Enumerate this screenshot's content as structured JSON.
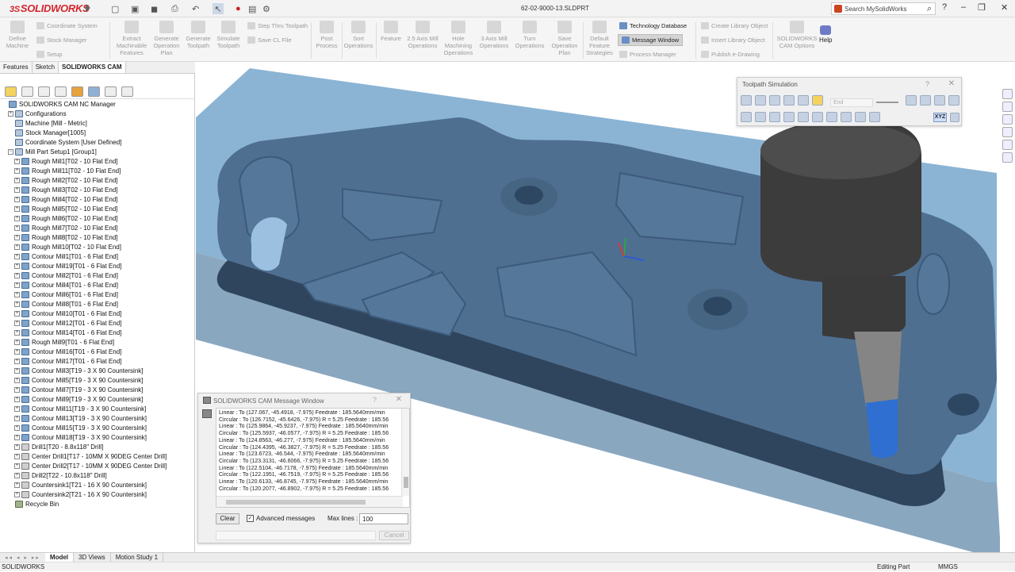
{
  "app": {
    "logo_prefix": "3S",
    "logo_text": "SOLIDWORKS",
    "document_title": "62-02-9000-13.SLDPRT"
  },
  "search": {
    "placeholder": "Search MySolidWorks",
    "icon": "search-icon"
  },
  "ribbon": {
    "define_machine": "Define Machine",
    "coordinate_system": "Coordinate System",
    "stock_manager": "Stock Manager",
    "setup": "Setup",
    "extract_features": "Extract Machinable Features",
    "generate_plan": "Generate Operation Plan",
    "generate_toolpath": "Generate Toolpath",
    "simulate_toolpath": "Simulate Toolpath",
    "step_thru": "Step Thru Toolpath",
    "save_cl": "Save CL File",
    "post_process": "Post Process",
    "sort_operations": "Sort Operations",
    "feature": "Feature",
    "axis25_mill": "2.5 Axis Mill Operations",
    "hole_machining": "Hole Machining Operations",
    "axis3_mill": "3 Axis Mill Operations",
    "turn_ops": "Turn Operations",
    "save_plan": "Save Operation Plan",
    "default_strategies": "Default Feature Strategies",
    "tech_db": "Technology Database",
    "message_window": "Message Window",
    "process_manager": "Process Manager",
    "create_library": "Create Library Object",
    "insert_library": "Insert Library Object",
    "publish_edrawing": "Publish e-Drawing",
    "cam_options": "SOLIDWORKS CAM Options",
    "help": "Help"
  },
  "panel": {
    "tabs": [
      "Features",
      "Sketch",
      "SOLIDWORKS CAM"
    ],
    "active_tab": "SOLIDWORKS CAM",
    "tree": [
      {
        "label": "SOLIDWORKS CAM NC Manager",
        "level": 0,
        "icon": "nc",
        "exp": "none"
      },
      {
        "label": "Configurations",
        "level": 1,
        "icon": "op",
        "exp": "plus"
      },
      {
        "label": "Machine [Mill - Metric]",
        "level": 1,
        "icon": "op",
        "exp": "none"
      },
      {
        "label": "Stock Manager[1005]",
        "level": 1,
        "icon": "op",
        "exp": "none"
      },
      {
        "label": "Coordinate System [User Defined]",
        "level": 1,
        "icon": "op",
        "exp": "none"
      },
      {
        "label": "Mill Part Setup1 [Group1]",
        "level": 1,
        "icon": "op",
        "exp": "minus"
      },
      {
        "label": "Rough Mill1[T02 - 10 Flat End]",
        "level": 2,
        "icon": "nc",
        "exp": "plus"
      },
      {
        "label": "Rough Mill11[T02 - 10 Flat End]",
        "level": 2,
        "icon": "nc",
        "exp": "plus"
      },
      {
        "label": "Rough Mill2[T02 - 10 Flat End]",
        "level": 2,
        "icon": "nc",
        "exp": "plus"
      },
      {
        "label": "Rough Mill3[T02 - 10 Flat End]",
        "level": 2,
        "icon": "nc",
        "exp": "plus"
      },
      {
        "label": "Rough Mill4[T02 - 10 Flat End]",
        "level": 2,
        "icon": "nc",
        "exp": "plus"
      },
      {
        "label": "Rough Mill5[T02 - 10 Flat End]",
        "level": 2,
        "icon": "nc",
        "exp": "plus"
      },
      {
        "label": "Rough Mill6[T02 - 10 Flat End]",
        "level": 2,
        "icon": "nc",
        "exp": "plus"
      },
      {
        "label": "Rough Mill7[T02 - 10 Flat End]",
        "level": 2,
        "icon": "nc",
        "exp": "plus"
      },
      {
        "label": "Rough Mill8[T02 - 10 Flat End]",
        "level": 2,
        "icon": "nc",
        "exp": "plus"
      },
      {
        "label": "Rough Mill10[T02 - 10 Flat End]",
        "level": 2,
        "icon": "nc",
        "exp": "plus"
      },
      {
        "label": "Contour Mill1[T01 - 6 Flat End]",
        "level": 2,
        "icon": "nc",
        "exp": "plus"
      },
      {
        "label": "Contour Mill19[T01 - 6 Flat End]",
        "level": 2,
        "icon": "nc",
        "exp": "plus"
      },
      {
        "label": "Contour Mill2[T01 - 6 Flat End]",
        "level": 2,
        "icon": "nc",
        "exp": "plus"
      },
      {
        "label": "Contour Mill4[T01 - 6 Flat End]",
        "level": 2,
        "icon": "nc",
        "exp": "plus"
      },
      {
        "label": "Contour Mill6[T01 - 6 Flat End]",
        "level": 2,
        "icon": "nc",
        "exp": "plus"
      },
      {
        "label": "Contour Mill8[T01 - 6 Flat End]",
        "level": 2,
        "icon": "nc",
        "exp": "plus"
      },
      {
        "label": "Contour Mill10[T01 - 6 Flat End]",
        "level": 2,
        "icon": "nc",
        "exp": "plus"
      },
      {
        "label": "Contour Mill12[T01 - 6 Flat End]",
        "level": 2,
        "icon": "nc",
        "exp": "plus"
      },
      {
        "label": "Contour Mill14[T01 - 6 Flat End]",
        "level": 2,
        "icon": "nc",
        "exp": "plus"
      },
      {
        "label": "Rough Mill9[T01 - 6 Flat End]",
        "level": 2,
        "icon": "nc",
        "exp": "plus"
      },
      {
        "label": "Contour Mill16[T01 - 6 Flat End]",
        "level": 2,
        "icon": "nc",
        "exp": "plus"
      },
      {
        "label": "Contour Mill17[T01 - 6 Flat End]",
        "level": 2,
        "icon": "nc",
        "exp": "plus"
      },
      {
        "label": "Contour Mill3[T19 - 3 X 90 Countersink]",
        "level": 2,
        "icon": "nc",
        "exp": "plus"
      },
      {
        "label": "Contour Mill5[T19 - 3 X 90 Countersink]",
        "level": 2,
        "icon": "nc",
        "exp": "plus"
      },
      {
        "label": "Contour Mill7[T19 - 3 X 90 Countersink]",
        "level": 2,
        "icon": "nc",
        "exp": "plus"
      },
      {
        "label": "Contour Mill9[T19 - 3 X 90 Countersink]",
        "level": 2,
        "icon": "nc",
        "exp": "plus"
      },
      {
        "label": "Contour Mill11[T19 - 3 X 90 Countersink]",
        "level": 2,
        "icon": "nc",
        "exp": "plus"
      },
      {
        "label": "Contour Mill13[T19 - 3 X 90 Countersink]",
        "level": 2,
        "icon": "nc",
        "exp": "plus"
      },
      {
        "label": "Contour Mill15[T19 - 3 X 90 Countersink]",
        "level": 2,
        "icon": "nc",
        "exp": "plus"
      },
      {
        "label": "Contour Mill18[T19 - 3 X 90 Countersink]",
        "level": 2,
        "icon": "nc",
        "exp": "plus"
      },
      {
        "label": "Drill1[T20 - 8.8x118\" Drill]",
        "level": 2,
        "icon": "drill",
        "exp": "plus"
      },
      {
        "label": "Center Drill1[T17 - 10MM X 90DEG Center Drill]",
        "level": 2,
        "icon": "drill",
        "exp": "plus"
      },
      {
        "label": "Center Drill2[T17 - 10MM X 90DEG Center Drill]",
        "level": 2,
        "icon": "drill",
        "exp": "plus"
      },
      {
        "label": "Drill2[T22 - 10.8x118\" Drill]",
        "level": 2,
        "icon": "drill",
        "exp": "plus"
      },
      {
        "label": "Countersink1[T21 - 16 X 90 Countersink]",
        "level": 2,
        "icon": "drill",
        "exp": "plus"
      },
      {
        "label": "Countersink2[T21 - 16 X 90 Countersink]",
        "level": 2,
        "icon": "drill",
        "exp": "plus"
      },
      {
        "label": "Recycle Bin",
        "level": 1,
        "icon": "bin",
        "exp": "none"
      }
    ]
  },
  "toolpath_sim": {
    "title": "Toolpath Simulation",
    "help": "?",
    "close": "✕",
    "end_placeholder": "End",
    "xyz": "XYZ"
  },
  "message_window": {
    "title": "SOLIDWORKS CAM Message Window",
    "help": "?",
    "close": "✕",
    "lines": [
      "Linear : To (127.067, -45.4918, -7.975) Feedrate : 185.5640mm/min",
      "Circular : To (126.7152, -45.6426, -7.975) R = 5.25 Feedrate : 185.56",
      "Linear : To (125.9864, -45.9237, -7.975) Feedrate : 185.5640mm/min",
      "Circular : To (125.5937, -46.0577, -7.975) R = 5.25 Feedrate : 185.56",
      "Linear : To (124.8563, -46.277, -7.975) Feedrate : 185.5640mm/min",
      "Circular : To (124.4395, -46.3827, -7.975) R = 5.25 Feedrate : 185.56",
      "Linear : To (123.6723, -46.544, -7.975) Feedrate : 185.5640mm/min",
      "Circular : To (123.3131, -46.6066, -7.975) R = 5.25 Feedrate : 185.56",
      "Linear : To (122.5104, -46.7178, -7.975) Feedrate : 185.5640mm/min",
      "Circular : To (122.1951, -46.7519, -7.975) R = 5.25 Feedrate : 185.56",
      "Linear : To (120.6133, -46.8745, -7.975) Feedrate : 185.5640mm/min",
      "Circular : To (120.2077, -46.8902, -7.975) R = 5.25 Feedrate : 185.56"
    ],
    "clear_label": "Clear",
    "advanced_label": "Advanced messages",
    "advanced_checked": true,
    "max_lines_label": "Max lines :",
    "max_lines_value": "100",
    "cancel_label": "Cancel"
  },
  "bottom_tabs": {
    "tabs": [
      "Model",
      "3D Views",
      "Motion Study 1"
    ],
    "active": "Model"
  },
  "status": {
    "left": "SOLIDWORKS",
    "mode": "Editing Part",
    "units": "MMGS"
  },
  "colors": {
    "part": "#4f6f91",
    "stock": "#8bb4d4",
    "tool_body": "#3c3c3c",
    "tool_tip": "#2e6fd1",
    "brand": "#d4262c"
  }
}
